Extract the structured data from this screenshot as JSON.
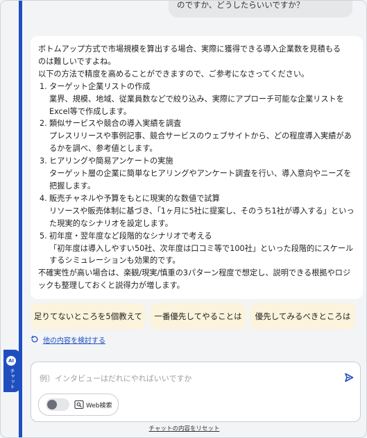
{
  "user_message": {
    "text": "のですか、どうしたらいいですか？"
  },
  "ai_response": {
    "intro_1": "ボトムアップ方式で市場規模を算出する場合、実際に獲得できる導入企業数を見積もる",
    "intro_2": "のは難しいですよね。",
    "intro_3": "以下の方法で精度を高めることができますので、ご参考になさってください。",
    "items": [
      {
        "num": "1.",
        "title": "ターゲット企業リストの作成",
        "detail": "業界、規模、地域、従業員数などで絞り込み、実際にアプローチ可能な企業リストをExcel等で作成します。"
      },
      {
        "num": "2.",
        "title": "類似サービスや競合の導入実績を調査",
        "detail": "プレスリリースや事例記事、競合サービスのウェブサイトから、どの程度導入実績があるかを調べ、参考値とします。"
      },
      {
        "num": "3.",
        "title": "ヒアリングや簡易アンケートの実施",
        "detail": "ターゲット層の企業に簡単なヒアリングやアンケート調査を行い、導入意向やニーズを把握します。"
      },
      {
        "num": "4.",
        "title": "販売チャネルや予算をもとに現実的な数値で試算",
        "detail": "リソースや販売体制に基づき、「1ヶ月に5社に提案し、そのうち1社が導入する」といった現実的なシナリオを設定します。"
      },
      {
        "num": "5.",
        "title": "初年度・翌年度など段階的なシナリオで考える",
        "detail": "「初年度は導入しやすい50社、次年度は口コミ等で100社」といった段階的にスケールするシミュレーションも効果的です。"
      }
    ],
    "outro": "不確実性が高い場合は、楽観/現実/慎重の3パターン程度で想定し、説明できる根拠やロジックも整理しておくと説得力が増します。"
  },
  "suggestions": [
    "足りてないところを5個教えて",
    "一番優先してやることは",
    "優先してみるべきところは"
  ],
  "more_options_label": "他の内容を検討する",
  "composer": {
    "placeholder": "例）インタビューはだれにやればいいですか",
    "value": "",
    "web_search_label": "Web検索",
    "web_search_enabled": false
  },
  "reset_label": "チャットの内容をリセット",
  "side_tab": {
    "badge": "AI",
    "label": "チャット"
  },
  "colors": {
    "accent": "#1f4fbf",
    "suggestion_bg": "#fbf3dc",
    "page_bg": "#f2f4f6"
  },
  "icons": {
    "refresh": "refresh-icon",
    "send": "send-icon",
    "web_search": "web-search-icon"
  }
}
